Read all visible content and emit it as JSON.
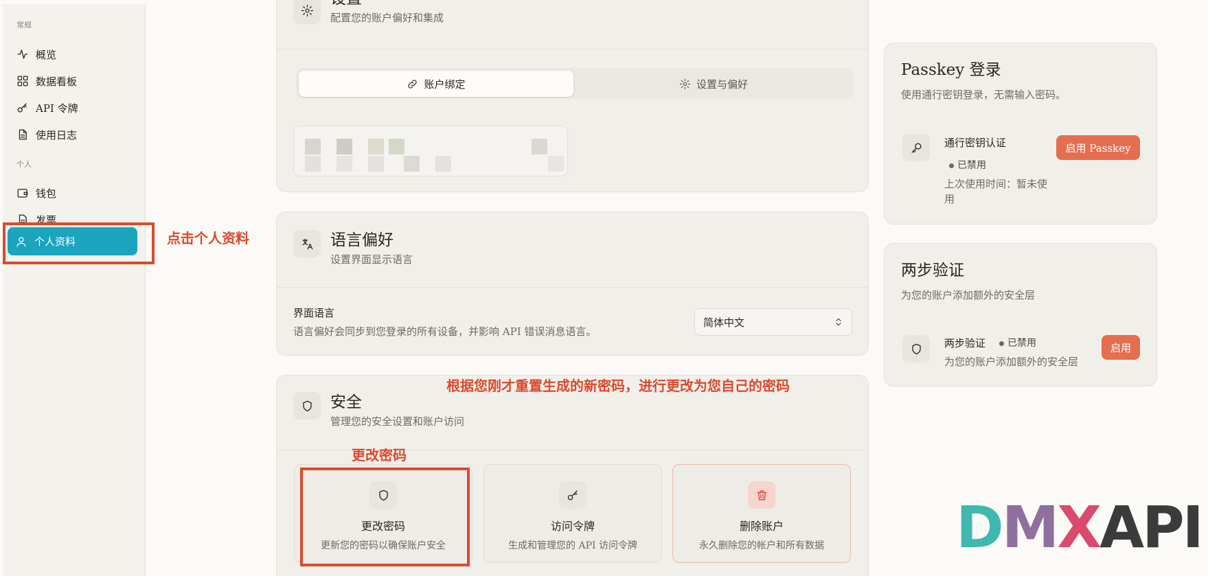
{
  "sidebar": {
    "group_general": "常规",
    "items_general": [
      {
        "label": "概览",
        "icon": "activity-icon"
      },
      {
        "label": "数据看板",
        "icon": "dashboard-icon"
      },
      {
        "label": "API 令牌",
        "icon": "key-icon"
      },
      {
        "label": "使用日志",
        "icon": "file-icon"
      }
    ],
    "group_personal": "个人",
    "items_personal": [
      {
        "label": "钱包",
        "icon": "wallet-icon"
      },
      {
        "label": "发票",
        "icon": "invoice-icon"
      }
    ],
    "active_label": "个人资料",
    "active_color": "#1aa4bd"
  },
  "annotations": {
    "click_profile": "点击个人资料",
    "change_instruction": "根据您刚才重置生成的新密码，进行更改为您自己的密码",
    "change_password": "更改密码",
    "color": "#d94a2e"
  },
  "settings": {
    "title": "设置",
    "subtitle": "配置您的账户偏好和集成",
    "tab_binding": "账户绑定",
    "tab_preferences": "设置与偏好"
  },
  "language": {
    "title": "语言偏好",
    "subtitle": "设置界面显示语言",
    "field_label": "界面语言",
    "field_desc": "语言偏好会同步到您登录的所有设备，并影响 API 错误消息语言。",
    "selected": "简体中文"
  },
  "security": {
    "title": "安全",
    "subtitle": "管理您的安全设置和账户访问",
    "tiles": [
      {
        "title": "更改密码",
        "sub": "更新您的密码以确保账户安全",
        "icon": "shield-icon"
      },
      {
        "title": "访问令牌",
        "sub": "生成和管理您的 API 访问令牌",
        "icon": "key-icon"
      },
      {
        "title": "删除账户",
        "sub": "永久删除您的帐户和所有数据",
        "icon": "trash-icon"
      }
    ]
  },
  "passkey": {
    "title": "Passkey 登录",
    "subtitle": "使用通行密钥登录，无需输入密码。",
    "item_title": "通行密钥认证",
    "status": "已禁用",
    "last_used": "上次使用时间：暂未使用",
    "button": "启用 Passkey"
  },
  "twofa": {
    "title": "两步验证",
    "subtitle": "为您的账户添加额外的安全层",
    "item_title": "两步验证",
    "status": "已禁用",
    "item_desc": "为您的账户添加额外的安全层",
    "button": "启用"
  },
  "logo": {
    "text_d": "D",
    "text_m": "M",
    "text_x": "X",
    "text_api": "API"
  },
  "colors": {
    "accent_orange": "#e46e4f",
    "logo_teal": "#3fb8b0",
    "logo_purple": "#8e6f9e",
    "logo_pink": "#d94a6e",
    "logo_dark": "#3b3b3b"
  }
}
